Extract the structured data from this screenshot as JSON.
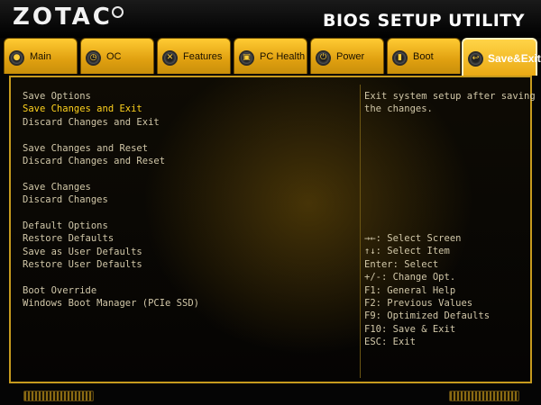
{
  "brand": {
    "logo": "ZOTAC",
    "utility_title": "BIOS SETUP UTILITY"
  },
  "tabs": [
    {
      "label": "Main",
      "icon": "main-icon",
      "active": false
    },
    {
      "label": "OC",
      "icon": "oc-icon",
      "active": false
    },
    {
      "label": "Features",
      "icon": "features-icon",
      "active": false
    },
    {
      "label": "PC Health",
      "icon": "pc-health-icon",
      "active": false
    },
    {
      "label": "Power",
      "icon": "power-icon",
      "active": false
    },
    {
      "label": "Boot",
      "icon": "boot-icon",
      "active": false
    },
    {
      "label": "Save&Exit",
      "icon": "save-exit-icon",
      "active": true
    }
  ],
  "menu": {
    "save_options_header": "Save Options",
    "save_changes_and_exit": "Save Changes and Exit",
    "discard_changes_and_exit": "Discard Changes and Exit",
    "save_changes_and_reset": "Save Changes and Reset",
    "discard_changes_and_reset": "Discard Changes and Reset",
    "save_changes": "Save Changes",
    "discard_changes": "Discard Changes",
    "default_options_header": "Default Options",
    "restore_defaults": "Restore Defaults",
    "save_as_user_defaults": "Save as User Defaults",
    "restore_user_defaults": "Restore User Defaults",
    "boot_override_header": "Boot Override",
    "windows_boot_manager": "Windows Boot Manager (PCIe SSD)"
  },
  "help": {
    "line1": "Exit system setup after saving",
    "line2": "the changes."
  },
  "keys": [
    "→←: Select Screen",
    "↑↓: Select Item",
    "Enter: Select",
    "+/-: Change Opt.",
    "F1: General Help",
    "F2: Previous Values",
    "F9: Optimized Defaults",
    "F10: Save & Exit",
    "ESC: Exit"
  ],
  "colors": {
    "accent": "#e0a010",
    "selected_text": "#ffd21e",
    "body_text": "#d1c7a8",
    "border": "#c69a1e"
  }
}
